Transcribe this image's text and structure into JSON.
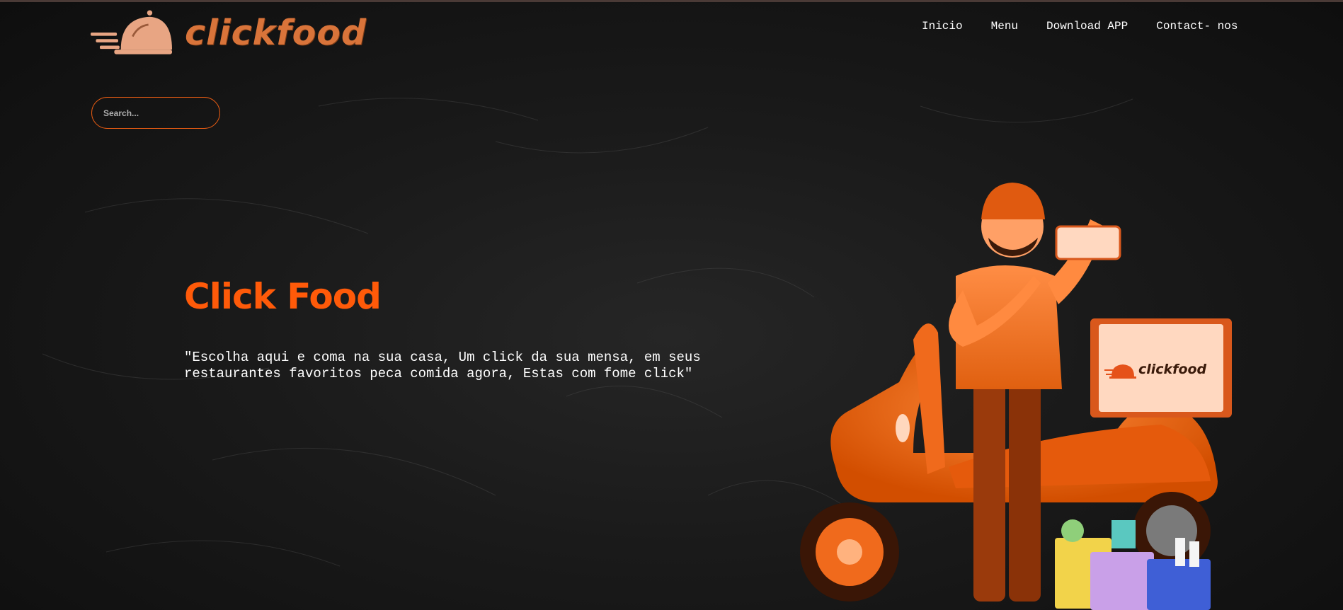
{
  "brand": {
    "name": "clickfood",
    "color": "#d9743a"
  },
  "nav": {
    "items": [
      {
        "label": "Inicio"
      },
      {
        "label": "Menu"
      },
      {
        "label": "Download APP"
      },
      {
        "label": "Contact- nos"
      }
    ]
  },
  "search": {
    "placeholder": "Search...",
    "value": ""
  },
  "hero": {
    "title": "Click Food",
    "text": "\"Escolha aqui e coma na sua casa, Um click da sua mensa, em seus restaurantes favoritos peca comida agora, Estas com fome click\""
  },
  "illustration": {
    "box_label": "clickfood"
  },
  "colors": {
    "accent": "#ff5a09",
    "border": "#e55b13",
    "background": "#161616"
  },
  "icons": {
    "logo": "delivery-cloche-icon"
  }
}
